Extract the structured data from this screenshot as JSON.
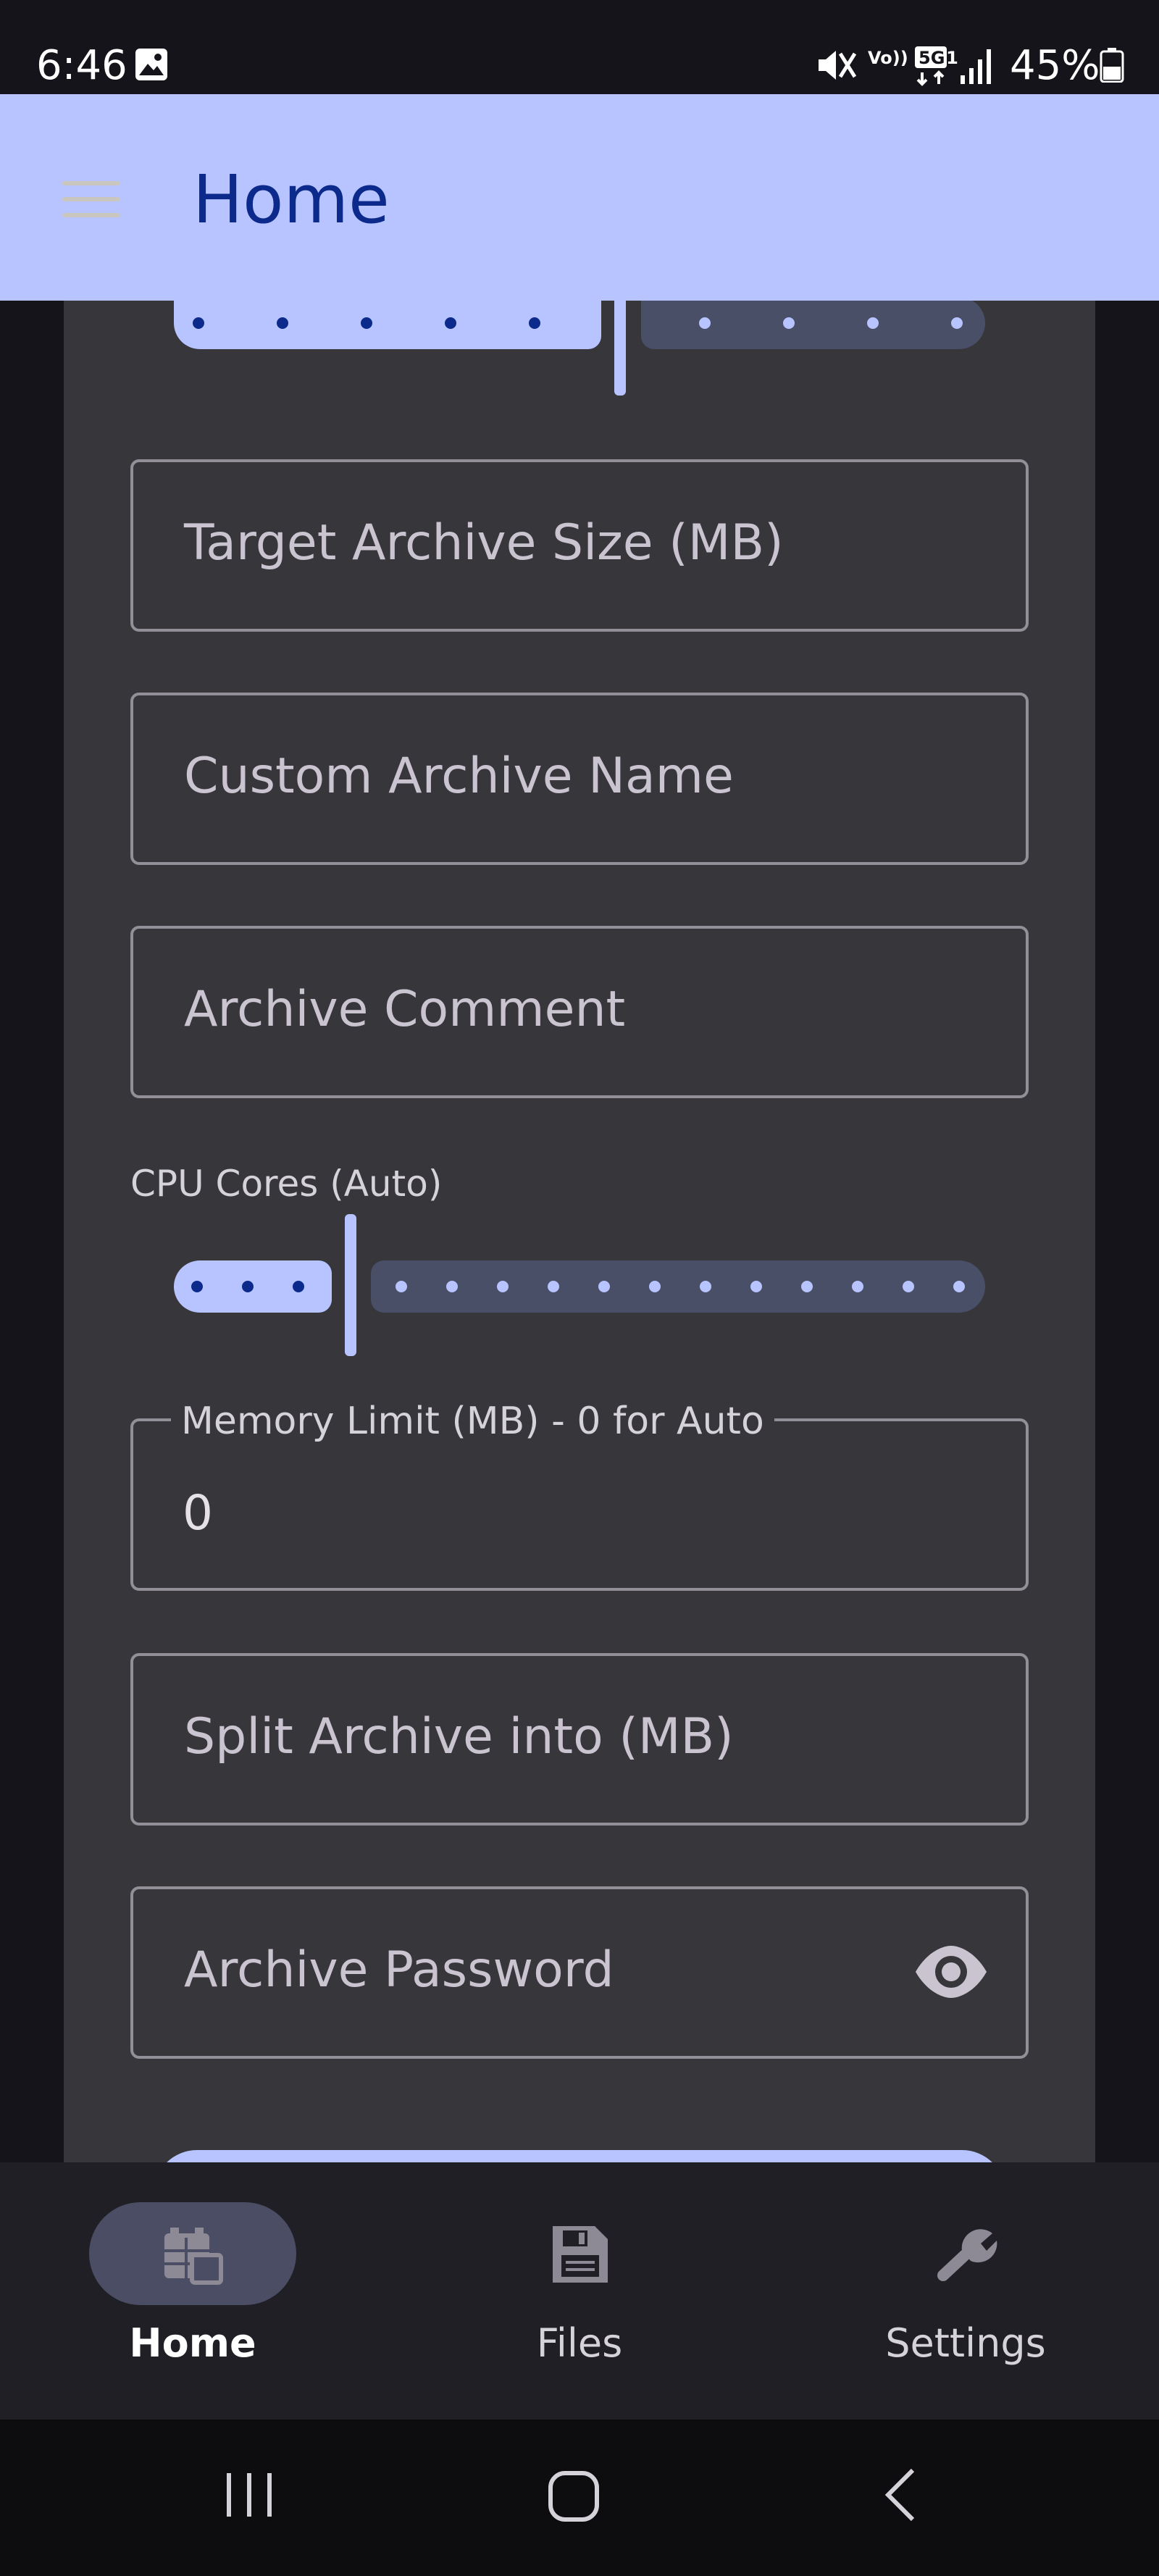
{
  "status_bar": {
    "time": "6:46",
    "battery": "45%",
    "icons": [
      "gallery-icon",
      "mute-icon",
      "volte-icon",
      "5g-icon",
      "signal-icon",
      "battery-icon"
    ],
    "network_labels": {
      "volte": "Vo)) LTE1",
      "five_g": "5G"
    }
  },
  "app_bar": {
    "title": "Home",
    "menu_icon": "menu-icon"
  },
  "form": {
    "compression_slider": {
      "level_fraction": 0.5
    },
    "target_size": {
      "label": "Target Archive Size (MB)"
    },
    "custom_name": {
      "label": "Custom Archive Name"
    },
    "comment": {
      "label": "Archive Comment"
    },
    "cpu_cores": {
      "label": "CPU Cores (Auto)",
      "level_fraction": 0.2
    },
    "memory_limit": {
      "label": "Memory Limit (MB) - 0 for Auto",
      "value": "0"
    },
    "split": {
      "label": "Split Archive into (MB)"
    },
    "password": {
      "label": "Archive Password",
      "icon": "eye-icon"
    }
  },
  "bottom_nav": {
    "items": [
      {
        "label": "Home",
        "icon": "home-icon",
        "selected": true
      },
      {
        "label": "Files",
        "icon": "save-icon",
        "selected": false
      },
      {
        "label": "Settings",
        "icon": "wrench-icon",
        "selected": false
      }
    ]
  },
  "system_nav": [
    "recents-icon",
    "home-circle-icon",
    "back-icon"
  ],
  "colors": {
    "app_bar": "#b8c4ff",
    "title": "#0c2a8b",
    "card": "#37363b",
    "background": "#15141a",
    "accent": "#b8c4ff",
    "nav_bar": "#201f25"
  }
}
